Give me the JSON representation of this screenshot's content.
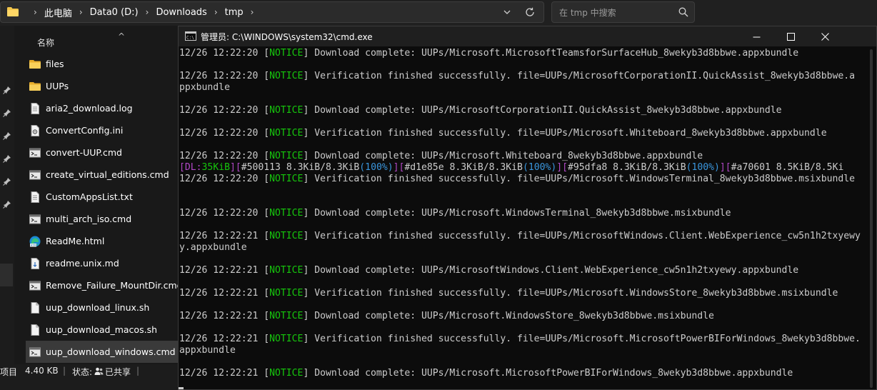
{
  "explorer": {
    "breadcrumb": [
      "此电脑",
      "Data0 (D:)",
      "Downloads",
      "tmp"
    ],
    "search_placeholder": "在 tmp 中搜索",
    "column_header": "名称",
    "files": [
      {
        "name": "files",
        "icon": "folder-icon"
      },
      {
        "name": "UUPs",
        "icon": "folder-icon"
      },
      {
        "name": "aria2_download.log",
        "icon": "text-file-icon"
      },
      {
        "name": "ConvertConfig.ini",
        "icon": "config-file-icon"
      },
      {
        "name": "convert-UUP.cmd",
        "icon": "cmd-file-icon"
      },
      {
        "name": "create_virtual_editions.cmd",
        "icon": "cmd-file-icon"
      },
      {
        "name": "CustomAppsList.txt",
        "icon": "text-file-icon"
      },
      {
        "name": "multi_arch_iso.cmd",
        "icon": "cmd-file-icon"
      },
      {
        "name": "ReadMe.html",
        "icon": "edge-html-icon"
      },
      {
        "name": "readme.unix.md",
        "icon": "markdown-file-icon"
      },
      {
        "name": "Remove_Failure_MountDir.cmd",
        "icon": "cmd-file-icon"
      },
      {
        "name": "uup_download_linux.sh",
        "icon": "file-icon"
      },
      {
        "name": "uup_download_macos.sh",
        "icon": "file-icon"
      },
      {
        "name": "uup_download_windows.cmd",
        "icon": "cmd-file-icon",
        "selected": true
      }
    ],
    "status": {
      "items_text": "项目",
      "size": "4.40 KB",
      "state_label": "状态:",
      "state_value": "已共享"
    }
  },
  "cmd": {
    "title": "管理员: C:\\WINDOWS\\system32\\cmd.exe",
    "lines": [
      {
        "segments": [
          {
            "t": "12/26 12:22:20 ["
          },
          {
            "t": "NOTICE",
            "c": "green"
          },
          {
            "t": "] Download complete: UUPs/Microsoft.MicrosoftTeamsforSurfaceHub_8wekyb3d8bbwe.appxbundle"
          }
        ]
      },
      {
        "segments": [
          {
            "t": ""
          }
        ]
      },
      {
        "segments": [
          {
            "t": "12/26 12:22:20 ["
          },
          {
            "t": "NOTICE",
            "c": "green"
          },
          {
            "t": "] Verification finished successfully. file=UUPs/MicrosoftCorporationII.QuickAssist_8wekyb3d8bbwe.a"
          }
        ]
      },
      {
        "segments": [
          {
            "t": "ppxbundle"
          }
        ]
      },
      {
        "segments": [
          {
            "t": ""
          }
        ]
      },
      {
        "segments": [
          {
            "t": "12/26 12:22:20 ["
          },
          {
            "t": "NOTICE",
            "c": "green"
          },
          {
            "t": "] Download complete: UUPs/MicrosoftCorporationII.QuickAssist_8wekyb3d8bbwe.appxbundle"
          }
        ]
      },
      {
        "segments": [
          {
            "t": ""
          }
        ]
      },
      {
        "segments": [
          {
            "t": "12/26 12:22:20 ["
          },
          {
            "t": "NOTICE",
            "c": "green"
          },
          {
            "t": "] Verification finished successfully. file=UUPs/Microsoft.Whiteboard_8wekyb3d8bbwe.appxbundle"
          }
        ]
      },
      {
        "segments": [
          {
            "t": ""
          }
        ]
      },
      {
        "segments": [
          {
            "t": "12/26 12:22:20 ["
          },
          {
            "t": "NOTICE",
            "c": "green"
          },
          {
            "t": "] Download complete: UUPs/Microsoft.Whiteboard_8wekyb3d8bbwe.appxbundle"
          }
        ]
      },
      {
        "segments": [
          {
            "t": "[DL:",
            "c": "purple"
          },
          {
            "t": "35KiB",
            "c": "green"
          },
          {
            "t": "][",
            "c": "purple"
          },
          {
            "t": "#500113 8.3KiB/8.3KiB"
          },
          {
            "t": "(100%)",
            "c": "cyan"
          },
          {
            "t": "][",
            "c": "purple"
          },
          {
            "t": "#d1e85e 8.3KiB/8.3KiB"
          },
          {
            "t": "(100%)",
            "c": "cyan"
          },
          {
            "t": "][",
            "c": "purple"
          },
          {
            "t": "#95dfa8 8.3KiB/8.3KiB"
          },
          {
            "t": "(100%)",
            "c": "cyan"
          },
          {
            "t": "][",
            "c": "purple"
          },
          {
            "t": "#a70601 8.5KiB/8.5Ki"
          }
        ]
      },
      {
        "segments": [
          {
            "t": "12/26 12:22:20 ["
          },
          {
            "t": "NOTICE",
            "c": "green"
          },
          {
            "t": "] Verification finished successfully. file=UUPs/Microsoft.WindowsTerminal_8wekyb3d8bbwe.msixbundle"
          }
        ]
      },
      {
        "segments": [
          {
            "t": ""
          }
        ]
      },
      {
        "segments": [
          {
            "t": ""
          }
        ]
      },
      {
        "segments": [
          {
            "t": "12/26 12:22:20 ["
          },
          {
            "t": "NOTICE",
            "c": "green"
          },
          {
            "t": "] Download complete: UUPs/Microsoft.WindowsTerminal_8wekyb3d8bbwe.msixbundle"
          }
        ]
      },
      {
        "segments": [
          {
            "t": ""
          }
        ]
      },
      {
        "segments": [
          {
            "t": "12/26 12:22:21 ["
          },
          {
            "t": "NOTICE",
            "c": "green"
          },
          {
            "t": "] Verification finished successfully. file=UUPs/MicrosoftWindows.Client.WebExperience_cw5n1h2txyewy"
          }
        ]
      },
      {
        "segments": [
          {
            "t": "y.appxbundle"
          }
        ]
      },
      {
        "segments": [
          {
            "t": ""
          }
        ]
      },
      {
        "segments": [
          {
            "t": "12/26 12:22:21 ["
          },
          {
            "t": "NOTICE",
            "c": "green"
          },
          {
            "t": "] Download complete: UUPs/MicrosoftWindows.Client.WebExperience_cw5n1h2txyewy.appxbundle"
          }
        ]
      },
      {
        "segments": [
          {
            "t": ""
          }
        ]
      },
      {
        "segments": [
          {
            "t": "12/26 12:22:21 ["
          },
          {
            "t": "NOTICE",
            "c": "green"
          },
          {
            "t": "] Verification finished successfully. file=UUPs/Microsoft.WindowsStore_8wekyb3d8bbwe.msixbundle"
          }
        ]
      },
      {
        "segments": [
          {
            "t": ""
          }
        ]
      },
      {
        "segments": [
          {
            "t": "12/26 12:22:21 ["
          },
          {
            "t": "NOTICE",
            "c": "green"
          },
          {
            "t": "] Download complete: UUPs/Microsoft.WindowsStore_8wekyb3d8bbwe.msixbundle"
          }
        ]
      },
      {
        "segments": [
          {
            "t": ""
          }
        ]
      },
      {
        "segments": [
          {
            "t": "12/26 12:22:21 ["
          },
          {
            "t": "NOTICE",
            "c": "green"
          },
          {
            "t": "] Verification finished successfully. file=UUPs/Microsoft.MicrosoftPowerBIForWindows_8wekyb3d8bbwe."
          }
        ]
      },
      {
        "segments": [
          {
            "t": "appxbundle"
          }
        ]
      },
      {
        "segments": [
          {
            "t": ""
          }
        ]
      },
      {
        "segments": [
          {
            "t": "12/26 12:22:21 ["
          },
          {
            "t": "NOTICE",
            "c": "green"
          },
          {
            "t": "] Download complete: UUPs/Microsoft.MicrosoftPowerBIForWindows_8wekyb3d8bbwe.appxbundle"
          }
        ]
      }
    ]
  },
  "colors": {
    "terminal_bg": "#0c0c0c",
    "terminal_text": "#cccccc",
    "notice_green": "#16c60c",
    "progress_purple": "#b148c6",
    "percent_cyan": "#3a96dd",
    "folder_yellow": "#f2c54b"
  }
}
